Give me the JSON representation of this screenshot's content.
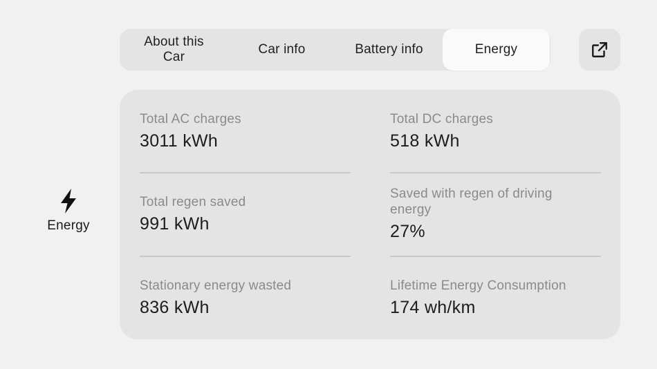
{
  "tabs": [
    {
      "label": "About this Car",
      "active": false
    },
    {
      "label": "Car info",
      "active": false
    },
    {
      "label": "Battery info",
      "active": false
    },
    {
      "label": "Energy",
      "active": true
    }
  ],
  "external_button": {
    "icon": "external-link-icon"
  },
  "section": {
    "label": "Energy",
    "icon": "lightning-bolt-icon"
  },
  "stats": [
    {
      "label": "Total AC charges",
      "value": "3011 kWh"
    },
    {
      "label": "Total DC charges",
      "value": "518 kWh"
    },
    {
      "label": "Total regen saved",
      "value": "991 kWh"
    },
    {
      "label": "Saved with regen of driving energy",
      "value": "27%"
    },
    {
      "label": "Stationary energy wasted",
      "value": "836 kWh"
    },
    {
      "label": "Lifetime Energy Consumption",
      "value": "174 wh/km"
    }
  ],
  "colors": {
    "background": "#f1f1f1",
    "panel": "#e4e4e4",
    "active_tab": "#fafafa",
    "label_text": "#8a8a8a",
    "value_text": "#1c1c1c"
  }
}
